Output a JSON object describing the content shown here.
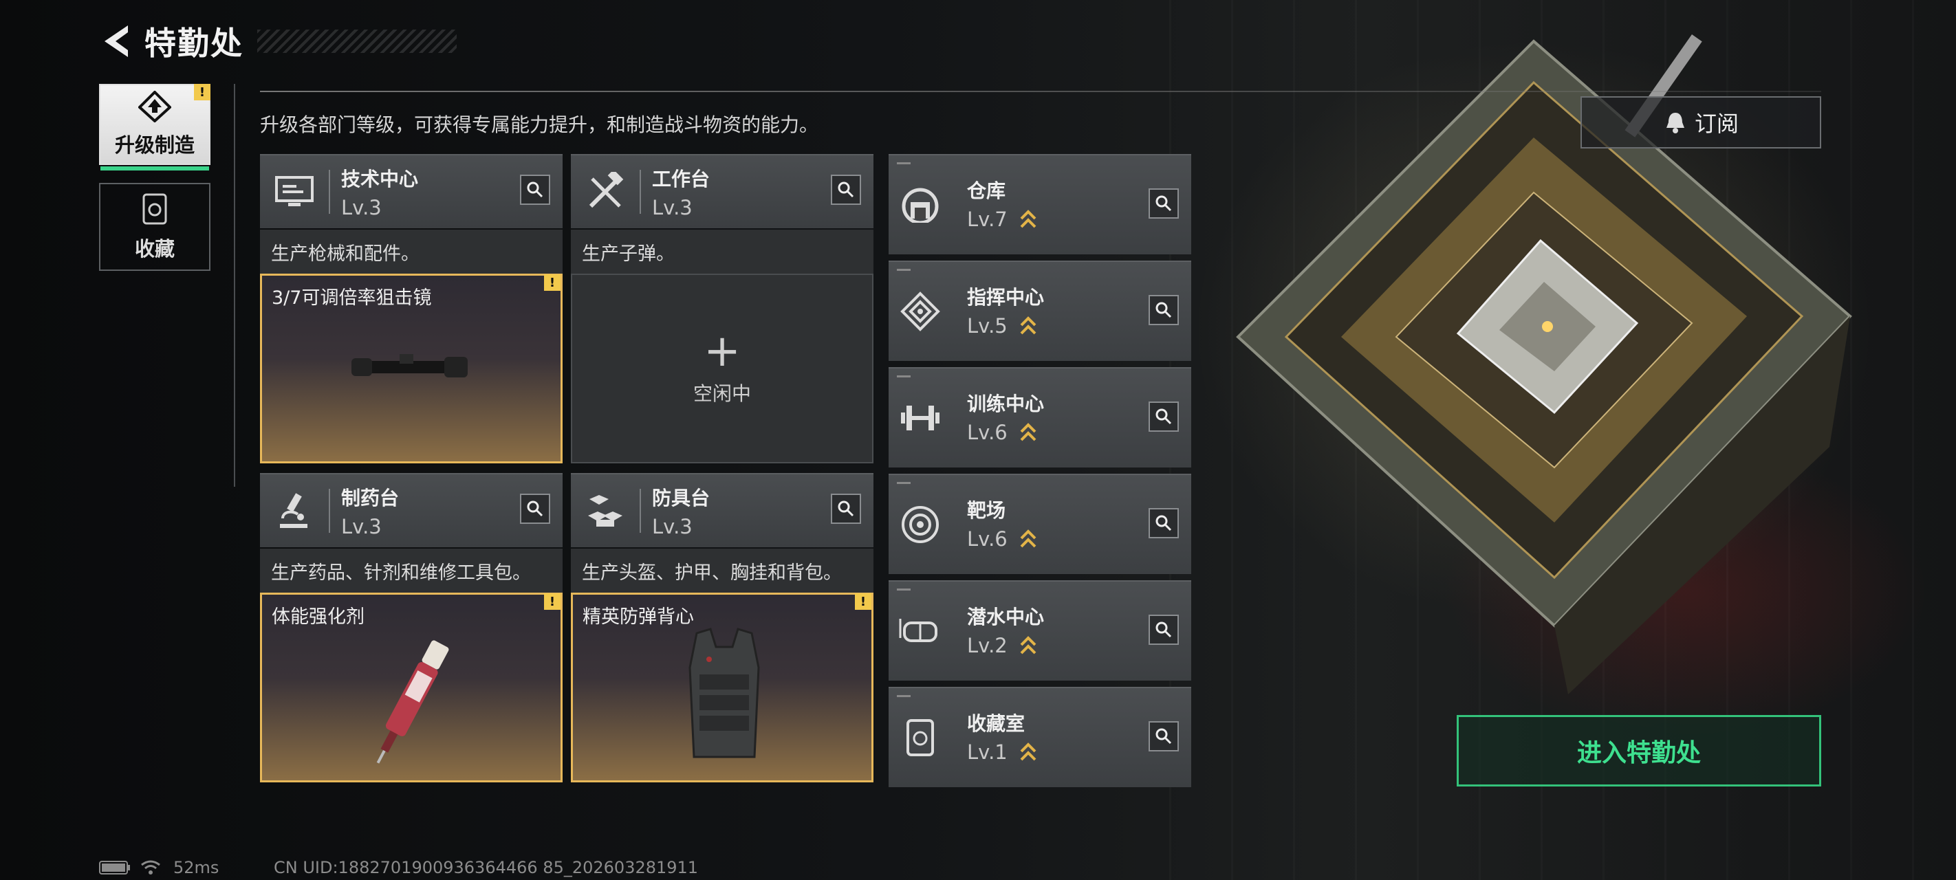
{
  "header": {
    "title": "特勤处"
  },
  "nav": [
    {
      "label": "升级制造",
      "active": true,
      "badge": "!"
    },
    {
      "label": "收藏",
      "active": false
    }
  ],
  "description": "升级各部门等级，可获得专属能力提升，和制造战斗物资的能力。",
  "subscribe_label": "订阅",
  "workshops": [
    {
      "name": "技术中心",
      "level": "Lv.3",
      "subtitle": "生产枪械和配件。",
      "slot_status": "producing",
      "item": "3/7可调倍率狙击镜",
      "badge": "!"
    },
    {
      "name": "工作台",
      "level": "Lv.3",
      "subtitle": "生产子弹。",
      "slot_status": "idle",
      "idle_text": "空闲中",
      "plus": "+"
    },
    {
      "name": "制药台",
      "level": "Lv.3",
      "subtitle": "生产药品、针剂和维修工具包。",
      "slot_status": "producing",
      "item": "体能强化剂",
      "badge": "!"
    },
    {
      "name": "防具台",
      "level": "Lv.3",
      "subtitle": "生产头盔、护甲、胸挂和背包。",
      "slot_status": "producing",
      "item": "精英防弹背心",
      "badge": "!"
    }
  ],
  "facilities": [
    {
      "name": "仓库",
      "level": "Lv.7",
      "icon": "warehouse-icon"
    },
    {
      "name": "指挥中心",
      "level": "Lv.5",
      "icon": "command-icon"
    },
    {
      "name": "训练中心",
      "level": "Lv.6",
      "icon": "dumbbell-icon"
    },
    {
      "name": "靶场",
      "level": "Lv.6",
      "icon": "target-icon"
    },
    {
      "name": "潜水中心",
      "level": "Lv.2",
      "icon": "diving-mask-icon"
    },
    {
      "name": "收藏室",
      "level": "Lv.1",
      "icon": "collection-icon"
    }
  ],
  "enter_button": "进入特勤处",
  "status": {
    "ping": "52ms",
    "uid": "CN UID:1882701900936364466 85_202603281911"
  },
  "colors": {
    "accent_green": "#3ee08f",
    "badge_yellow": "#f2c94c",
    "upgrade_gold": "#e3b448"
  }
}
